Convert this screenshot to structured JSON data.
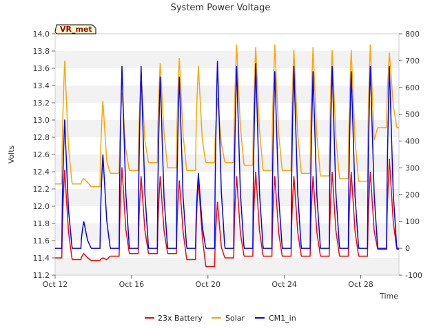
{
  "chart_data": {
    "type": "line",
    "title": "System Power Voltage",
    "badge": "VR_met",
    "xlabel": "Time",
    "ylabel": "Volts",
    "ylim": [
      11.2,
      14.0
    ],
    "y2lim": [
      -100,
      800
    ],
    "xlim": [
      0,
      18
    ],
    "x_origin_label": "Oct 12",
    "grid": "horizontal bands",
    "legend_position": "bottom",
    "y_ticks": [
      "11.2",
      "11.4",
      "11.6",
      "11.8",
      "12.0",
      "12.2",
      "12.4",
      "12.6",
      "12.8",
      "13.0",
      "13.2",
      "13.4",
      "13.6",
      "13.8",
      "14.0"
    ],
    "y2_ticks": [
      "-100",
      "0",
      "100",
      "200",
      "300",
      "400",
      "500",
      "600",
      "700",
      "800"
    ],
    "x_ticks": [
      {
        "day": 0,
        "label": "Oct 12"
      },
      {
        "day": 4,
        "label": "Oct 16"
      },
      {
        "day": 8,
        "label": "Oct 20"
      },
      {
        "day": 12,
        "label": "Oct 24"
      },
      {
        "day": 16,
        "label": "Oct 28"
      }
    ],
    "series": [
      {
        "name": "23x Battery",
        "axis": "left",
        "color": "#ff0000",
        "peaks": [
          12.42,
          11.45,
          11.4,
          12.45,
          12.35,
          12.35,
          12.3,
          12.3,
          12.05,
          12.35,
          12.4,
          12.35,
          12.35,
          12.35,
          12.4,
          12.4,
          12.4,
          12.55
        ],
        "nights": [
          11.4,
          11.38,
          11.37,
          11.42,
          11.45,
          11.45,
          11.45,
          11.38,
          11.3,
          11.4,
          11.42,
          11.42,
          11.42,
          11.42,
          11.42,
          11.42,
          11.42,
          11.5
        ]
      },
      {
        "name": "Solar",
        "axis": "right",
        "color": "#ffa500",
        "peaks": [
          700,
          260,
          550,
          580,
          660,
          690,
          710,
          680,
          560,
          760,
          750,
          760,
          740,
          750,
          740,
          740,
          760,
          730
        ],
        "nights": [
          240,
          240,
          230,
          280,
          290,
          320,
          300,
          290,
          320,
          320,
          310,
          290,
          290,
          280,
          270,
          260,
          250,
          450
        ]
      },
      {
        "name": "CM1_in",
        "axis": "right",
        "color": "#0000ff",
        "peaks": [
          480,
          100,
          350,
          680,
          680,
          640,
          640,
          280,
          700,
          680,
          690,
          660,
          680,
          660,
          680,
          660,
          680,
          680
        ],
        "nights": [
          0,
          0,
          0,
          0,
          0,
          0,
          0,
          0,
          0,
          0,
          0,
          0,
          0,
          0,
          0,
          0,
          0,
          0
        ]
      }
    ]
  }
}
